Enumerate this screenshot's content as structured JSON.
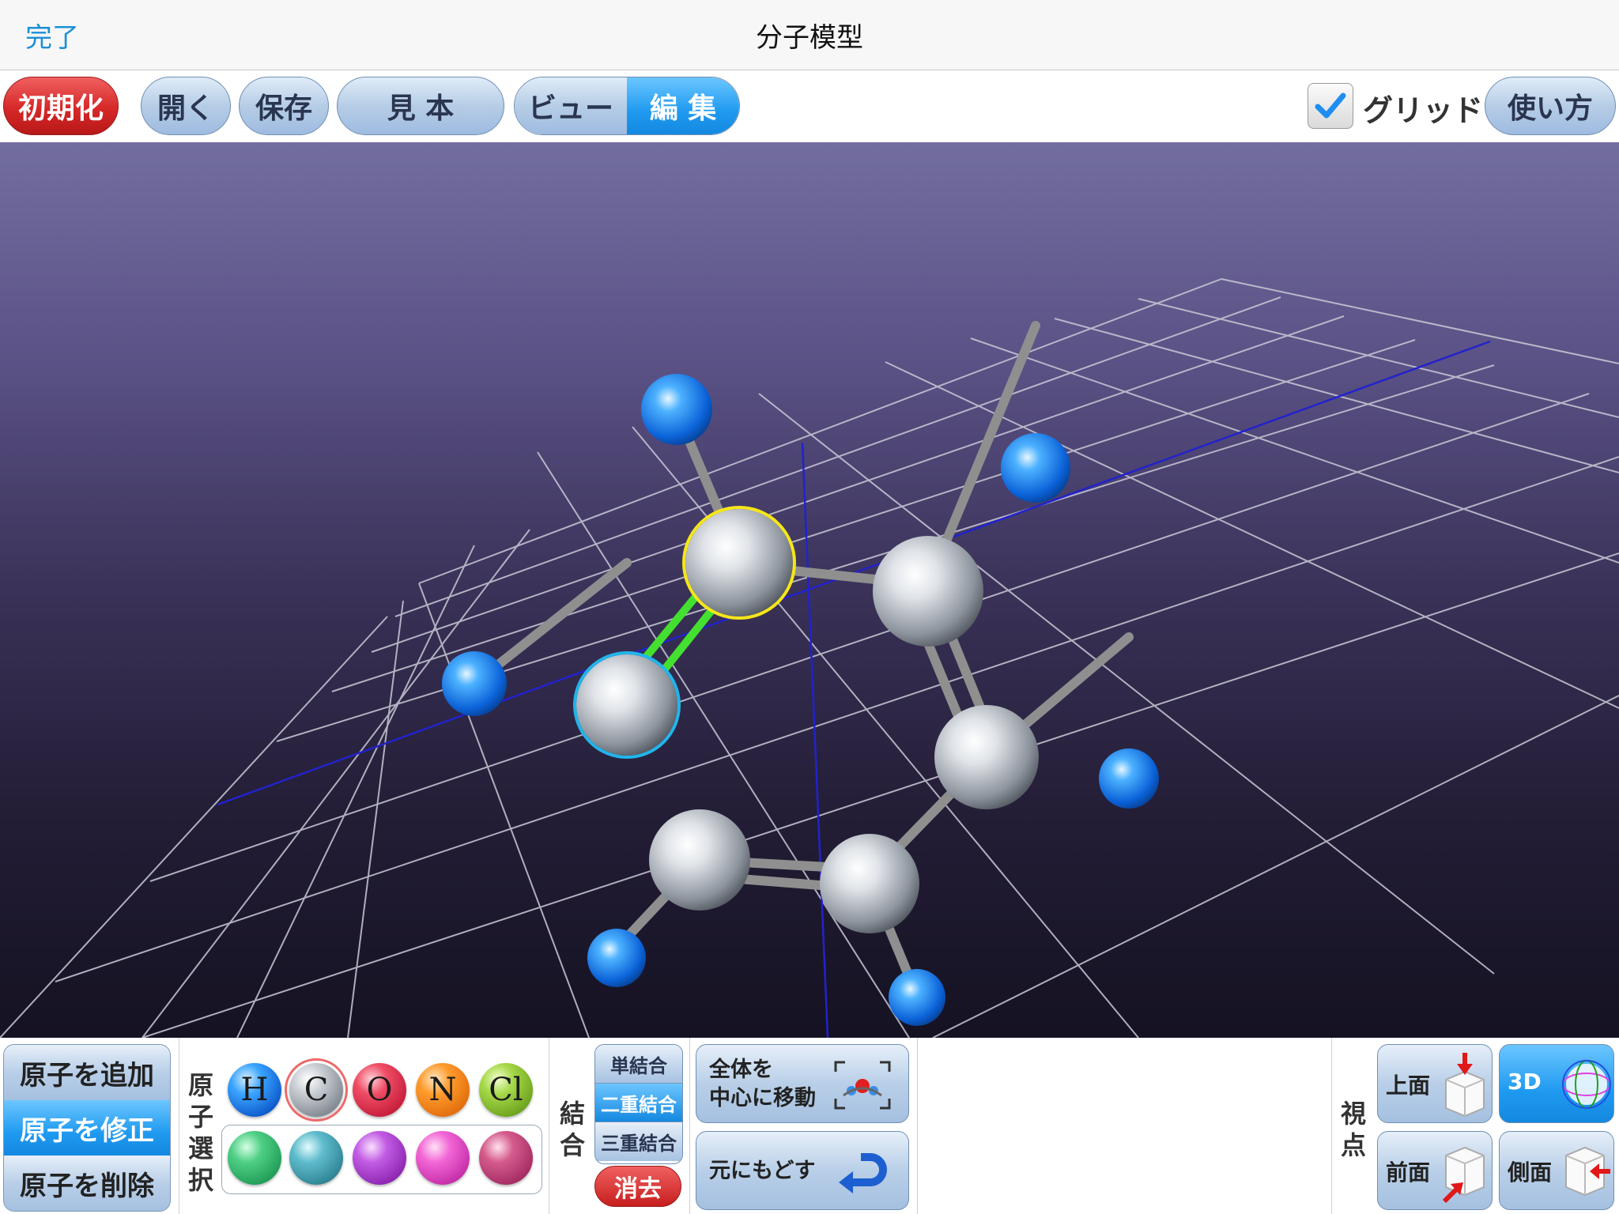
{
  "nav": {
    "done": "完了",
    "title": "分子模型"
  },
  "toolbar": {
    "reset": "初期化",
    "open": "開く",
    "save": "保存",
    "samples": "見 本",
    "view": "ビュー",
    "edit": "編 集",
    "grid_label": "グリッド",
    "grid_checked": true,
    "help": "使い方"
  },
  "colors": {
    "accent_blue": "#1f9af0",
    "danger_red": "#d62828",
    "selected_atom_ring": "#f5e61a",
    "selected_atom2_ring": "#22b4ea",
    "selected_bond": "#44e030"
  },
  "modes": {
    "add": "原子を追加",
    "modify": "原子を修正",
    "delete": "原子を削除",
    "active": "modify"
  },
  "atom_select": {
    "label": "原子選択",
    "elements": [
      "H",
      "C",
      "O",
      "N",
      "Cl"
    ],
    "selected": "C"
  },
  "bond": {
    "label": "結合",
    "single": "単結合",
    "double": "二重結合",
    "triple": "三重結合",
    "delete": "消去",
    "active": "double"
  },
  "actions": {
    "center_line1": "全体を",
    "center_line2": "中心に移動",
    "undo": "元にもどす"
  },
  "viewpoint": {
    "label": "視点",
    "top": "上面",
    "three_d": "3D",
    "front": "前面",
    "side": "側面",
    "active": "3D"
  }
}
